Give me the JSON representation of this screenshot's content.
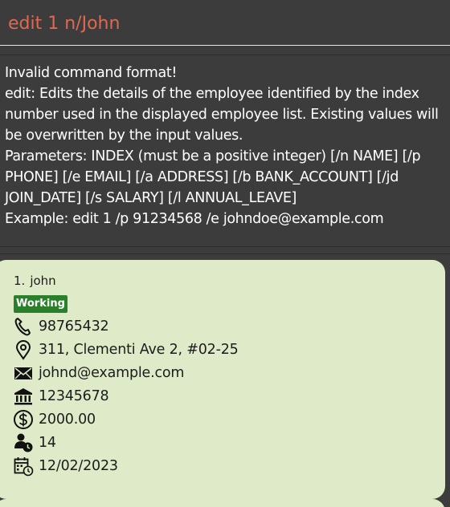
{
  "command_box": {
    "input_value": "edit 1 n/John"
  },
  "result_display": {
    "text": "Invalid command format!\nedit: Edits the details of the employee identified by the index number used in the displayed employee list. Existing values will be overwritten by the input values.\nParameters: INDEX (must be a positive integer) [/n NAME] [/p PHONE] [/e EMAIL] [/a ADDRESS] [/b BANK_ACCOUNT] [/jd JOIN_DATE] [/s SALARY] [/l ANNUAL_LEAVE]\nExample: edit 1 /p 91234568 /e johndoe@example.com"
  },
  "employee_list": {
    "cards": [
      {
        "index": "1.",
        "name": "john",
        "status": "Working",
        "phone": "98765432",
        "address": "311, Clementi Ave 2, #02-25",
        "email": "johnd@example.com",
        "bank_account": "12345678",
        "salary": "2000.00",
        "annual_leave": "14",
        "join_date": "12/02/2023"
      }
    ]
  },
  "colors": {
    "command_text": "#e06850",
    "background": "#3c3c3c",
    "card_background": "#dfebc8",
    "status_badge": "#2a7f2a"
  },
  "icons": [
    "phone-icon",
    "location-pin-icon",
    "envelope-icon",
    "bank-icon",
    "dollar-coin-icon",
    "person-clock-icon",
    "calendar-clock-icon"
  ]
}
